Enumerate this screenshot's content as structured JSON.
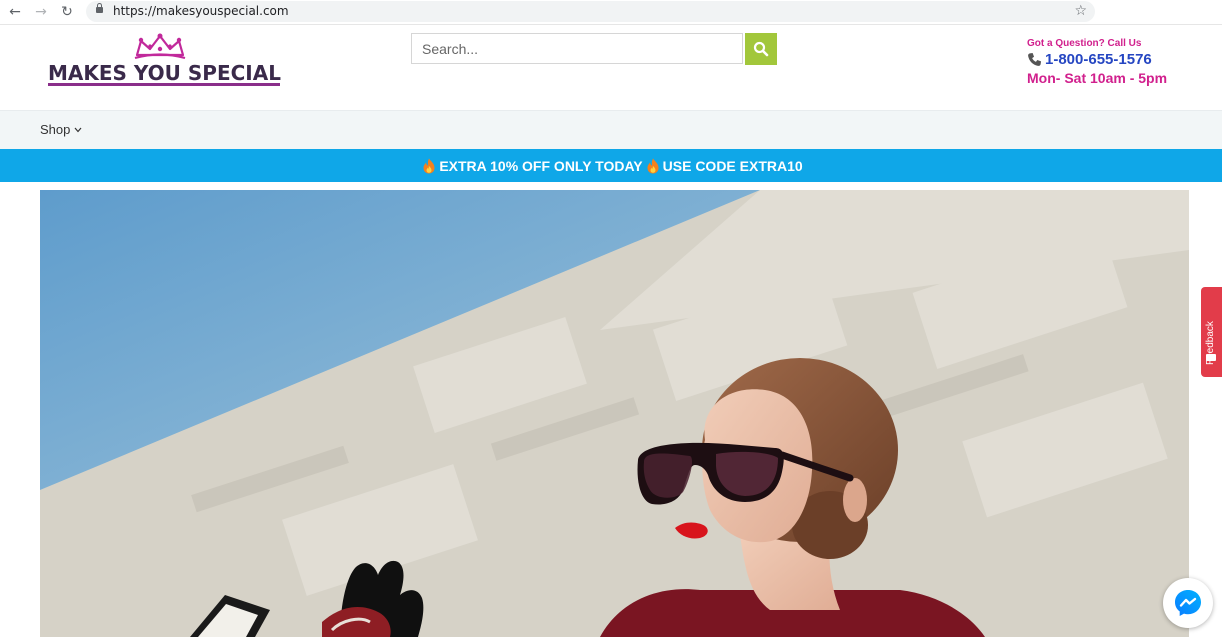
{
  "browser": {
    "url": "https://makesyouspecial.com"
  },
  "header": {
    "logo_text": "MAKES YOU SPECIAL",
    "search_placeholder": "Search...",
    "contact": {
      "question": "Got a Question? Call Us",
      "phone": "1-800-655-1576",
      "hours": "Mon- Sat 10am - 5pm"
    }
  },
  "nav": {
    "shop_label": "Shop"
  },
  "promo": {
    "part1": "EXTRA 10% OFF ONLY TODAY",
    "part2": "USE CODE EXTRA10"
  },
  "feedback": {
    "label": "Feedback"
  },
  "colors": {
    "brand_pink": "#d1208d",
    "brand_purple": "#8a2e8a",
    "promo_blue": "#0fa7e8",
    "search_green": "#a2c73b",
    "phone_blue": "#2546c2",
    "feedback_red": "#e23c4a"
  },
  "icons": {
    "back": "back-arrow-icon",
    "forward": "forward-arrow-icon",
    "reload": "reload-icon",
    "lock": "lock-icon",
    "bookmark": "star-icon",
    "search": "search-icon",
    "phone": "phone-icon",
    "fire": "fire-icon",
    "messenger": "messenger-icon",
    "chevron": "chevron-down-icon"
  }
}
